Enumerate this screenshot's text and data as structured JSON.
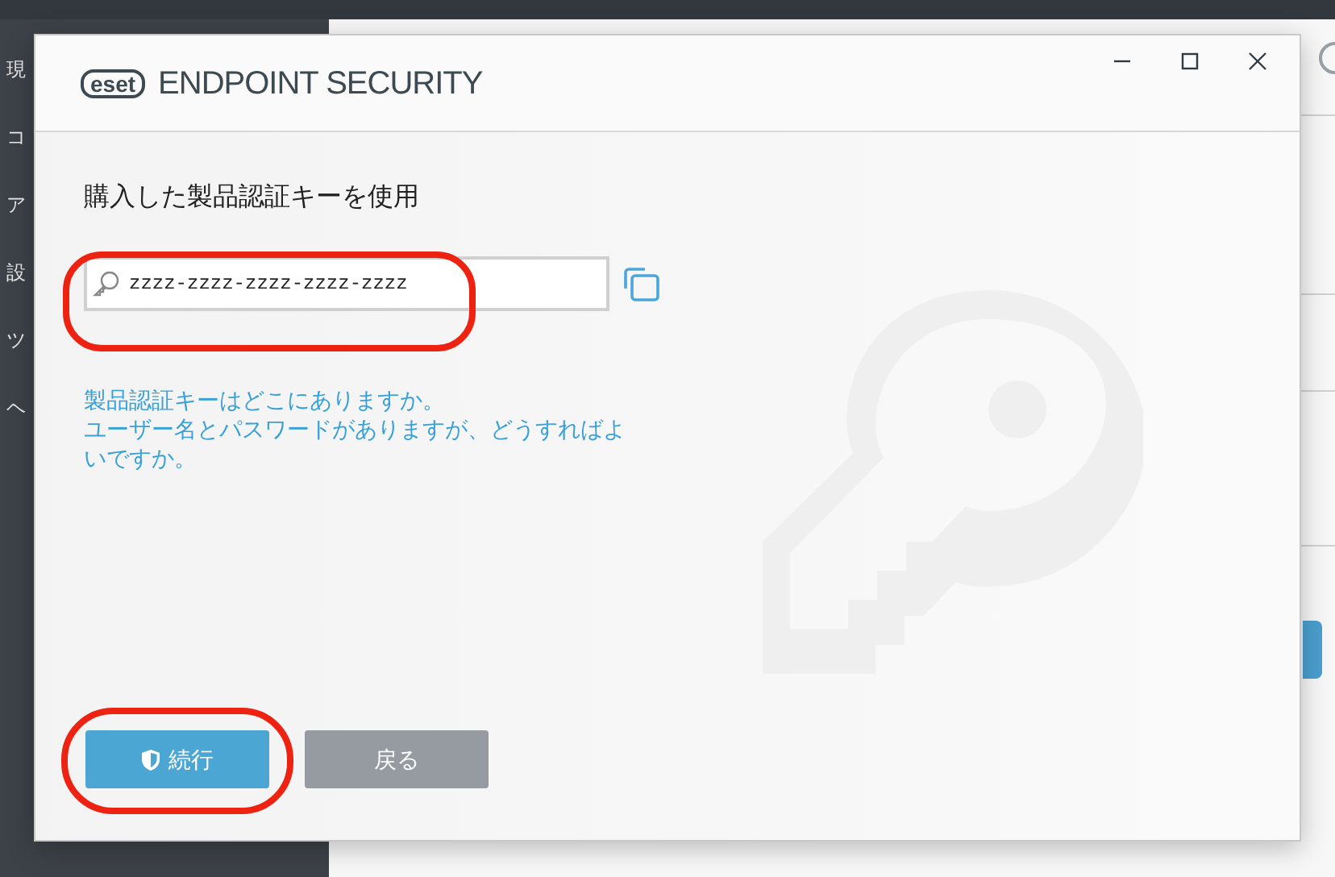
{
  "background_app": {
    "sidebar_items": [
      "現",
      "コ",
      "ア",
      "設",
      "ツ",
      "ヘ"
    ]
  },
  "dialog": {
    "logo": "eset",
    "title": "ENDPOINT SECURITY",
    "heading": "購入した製品認証キーを使用",
    "license_field": {
      "value": "zzzz-zzzz-zzzz-zzzz-zzzz"
    },
    "links": [
      "製品認証キーはどこにありますか。",
      "ユーザー名とパスワードがありますが、どうすればよいですか。"
    ],
    "buttons": [
      {
        "label": "続行",
        "kind": "primary"
      },
      {
        "label": "戻る",
        "kind": "secondary"
      }
    ]
  }
}
